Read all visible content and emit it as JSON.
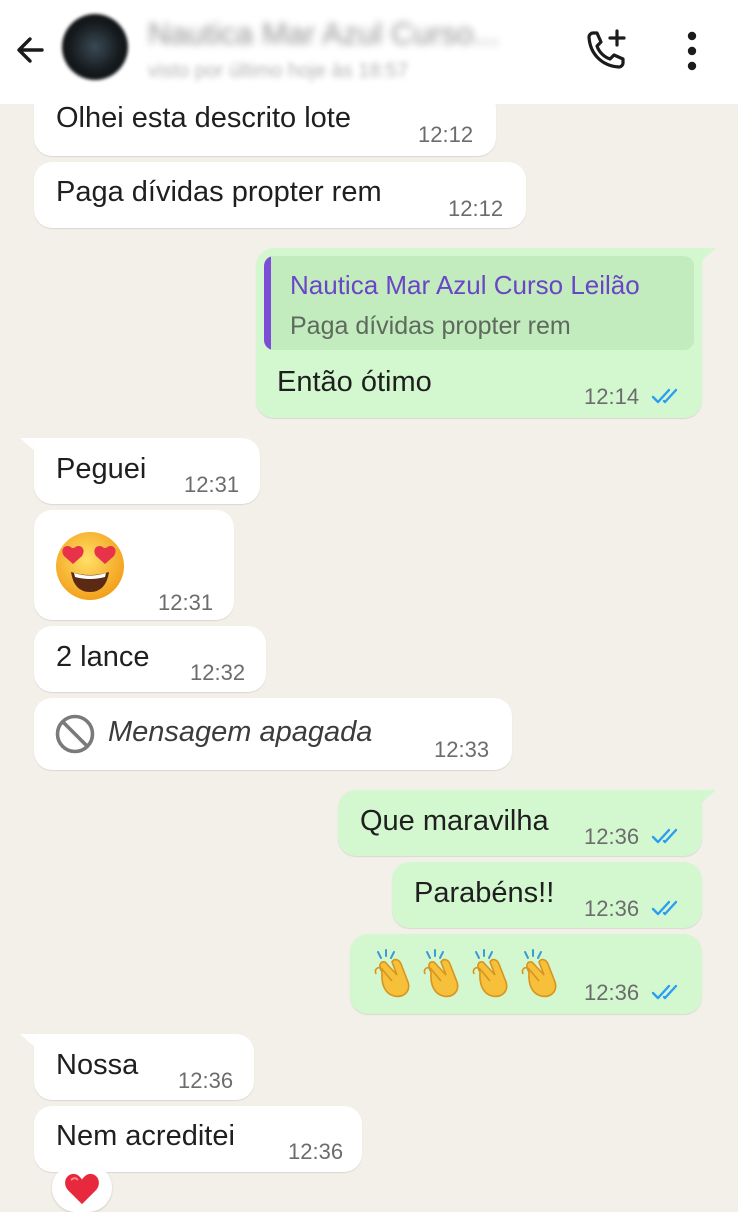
{
  "header": {
    "contact_name": "Nautica Mar Azul Curso...",
    "status": "visto por último hoje às 18:57",
    "back_icon": "arrow-left-icon",
    "add_call_icon": "add-call-icon",
    "menu_icon": "more-vertical-icon"
  },
  "colors": {
    "incoming": "#ffffff",
    "outgoing": "#d3f8cf",
    "read_ticks": "#2a9df4",
    "quote_author": "#6a45c7"
  },
  "messages": [
    {
      "direction": "in",
      "text": "Olhei esta descrito lote",
      "time": "12:12"
    },
    {
      "direction": "in",
      "text": "Paga dívidas propter rem",
      "time": "12:12"
    },
    {
      "direction": "out",
      "quote_author": "Nautica Mar Azul Curso Leilão",
      "quote_text": "Paga dívidas propter rem",
      "text": "Então ótimo",
      "time": "12:14",
      "status": "read"
    },
    {
      "direction": "in",
      "text": "Peguei",
      "time": "12:31"
    },
    {
      "direction": "in",
      "emoji": "heart-eyes-emoji",
      "time": "12:31"
    },
    {
      "direction": "in",
      "text": "2 lance",
      "time": "12:32"
    },
    {
      "direction": "in",
      "deleted": true,
      "text": "Mensagem apagada",
      "time": "12:33",
      "icon": "blocked-icon"
    },
    {
      "direction": "out",
      "text": "Que maravilha",
      "time": "12:36",
      "status": "read"
    },
    {
      "direction": "out",
      "text": "Parabéns!!",
      "time": "12:36",
      "status": "read"
    },
    {
      "direction": "out",
      "emoji": "clapping-hands-emoji x4",
      "time": "12:36",
      "status": "read"
    },
    {
      "direction": "in",
      "text": "Nossa",
      "time": "12:36"
    },
    {
      "direction": "in",
      "text": "Nem acreditei",
      "time": "12:36",
      "reaction": "red-heart-emoji"
    }
  ]
}
